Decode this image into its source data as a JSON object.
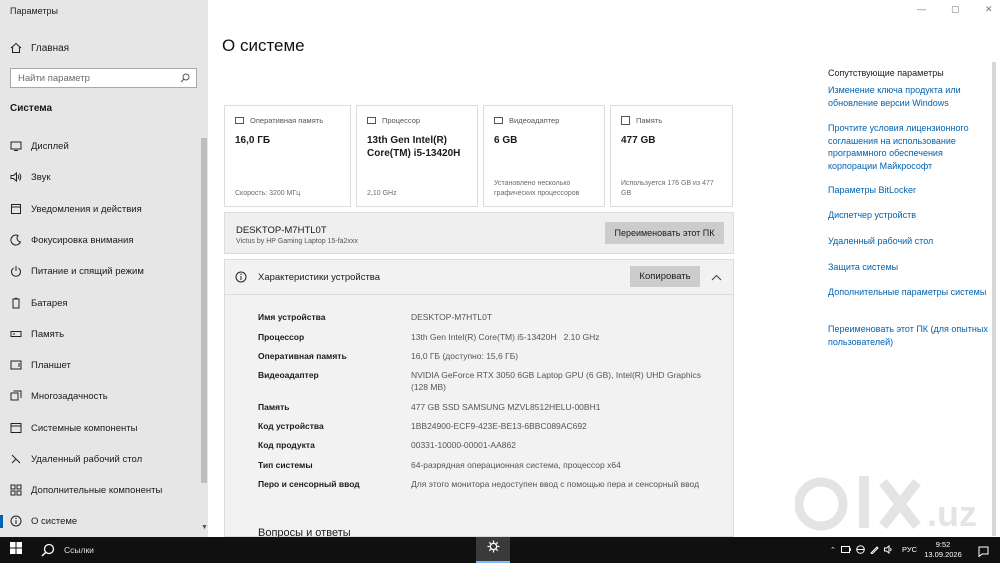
{
  "window": {
    "title": "Параметры",
    "minimize": "—",
    "maximize": "▢",
    "close": "✕"
  },
  "sidebar": {
    "home": "Главная",
    "search_placeholder": "Найти параметр",
    "section": "Система",
    "items": [
      {
        "label": "Дисплей",
        "icon": "display-icon"
      },
      {
        "label": "Звук",
        "icon": "sound-icon"
      },
      {
        "label": "Уведомления и действия",
        "icon": "notifications-icon"
      },
      {
        "label": "Фокусировка внимания",
        "icon": "focus-assist-icon"
      },
      {
        "label": "Питание и спящий режим",
        "icon": "power-icon"
      },
      {
        "label": "Батарея",
        "icon": "battery-icon"
      },
      {
        "label": "Память",
        "icon": "storage-icon"
      },
      {
        "label": "Планшет",
        "icon": "tablet-icon"
      },
      {
        "label": "Многозадачность",
        "icon": "multitasking-icon"
      },
      {
        "label": "Системные компоненты",
        "icon": "system-components-icon"
      },
      {
        "label": "Удаленный рабочий стол",
        "icon": "remote-desktop-icon"
      },
      {
        "label": "Дополнительные компоненты",
        "icon": "optional-features-icon"
      },
      {
        "label": "О системе",
        "icon": "about-icon"
      }
    ],
    "active": "О системе"
  },
  "main": {
    "title": "О системе",
    "cards": [
      {
        "label": "Оперативная память",
        "value": "16,0 ГБ",
        "sub": "Скорость: 3200 МГц",
        "icon": "ram-icon"
      },
      {
        "label": "Процессор",
        "value": "13th Gen Intel(R) Core(TM) i5-13420H",
        "sub": "2,10 GHz",
        "icon": "cpu-icon"
      },
      {
        "label": "Видеоадаптер",
        "value": "6 GB",
        "sub": "Установлено несколько графических процессоров",
        "icon": "gpu-icon"
      },
      {
        "label": "Память",
        "value": "477 GB",
        "sub": "Используется 176 GB из 477 GB",
        "icon": "disk-icon"
      }
    ],
    "device_name": "DESKTOP-M7HTL0T",
    "device_model": "Victus by HP Gaming Laptop 15-fa2xxx",
    "rename_button": "Переименовать этот ПК",
    "specs_title": "Характеристики устройства",
    "copy_button": "Копировать",
    "specs": [
      {
        "label": "Имя устройства",
        "value": "DESKTOP-M7HTL0T"
      },
      {
        "label": "Процессор",
        "value": "13th Gen Intel(R) Core(TM) i5-13420H   2.10 GHz"
      },
      {
        "label": "Оперативная память",
        "value": "16,0 ГБ (доступно: 15,6 ГБ)"
      },
      {
        "label": "Видеоадаптер",
        "value": "NVIDIA GeForce RTX 3050 6GB Laptop GPU (6 GB), Intel(R) UHD Graphics (128 MB)"
      },
      {
        "label": "Память",
        "value": "477 GB SSD SAMSUNG MZVL8512HELU-00BH1"
      },
      {
        "label": "Код устройства",
        "value": "1BB24900-ECF9-423E-BE13-6BBC089AC692"
      },
      {
        "label": "Код продукта",
        "value": "00331-10000-00001-AA862"
      },
      {
        "label": "Тип системы",
        "value": "64-разрядная операционная система, процессор x64"
      },
      {
        "label": "Перо и сенсорный ввод",
        "value": "Для этого монитора недоступен ввод с помощью пера и сенсорный ввод"
      }
    ],
    "qa_title": "Вопросы и ответы"
  },
  "related": {
    "title": "Сопутствующие параметры",
    "links": [
      "Изменение ключа продукта или обновление версии Windows",
      "Прочтите условия лицензионного соглашения на использование программного обеспечения корпорации Майкрософт",
      "Параметры BitLocker",
      "Диспетчер устройств",
      "Удаленный рабочий стол",
      "Защита системы",
      "Дополнительные параметры системы",
      "Переименовать этот ПК (для опытных пользователей)"
    ]
  },
  "taskbar": {
    "search_label": "Ссылки",
    "language": "РУС",
    "time": "9:52",
    "date": "13.09.2026"
  },
  "watermark": "olx.uz",
  "colors": {
    "accent": "#0063b1",
    "sidebar_bg": "#e6e6e6",
    "taskbar_bg": "#101010"
  }
}
